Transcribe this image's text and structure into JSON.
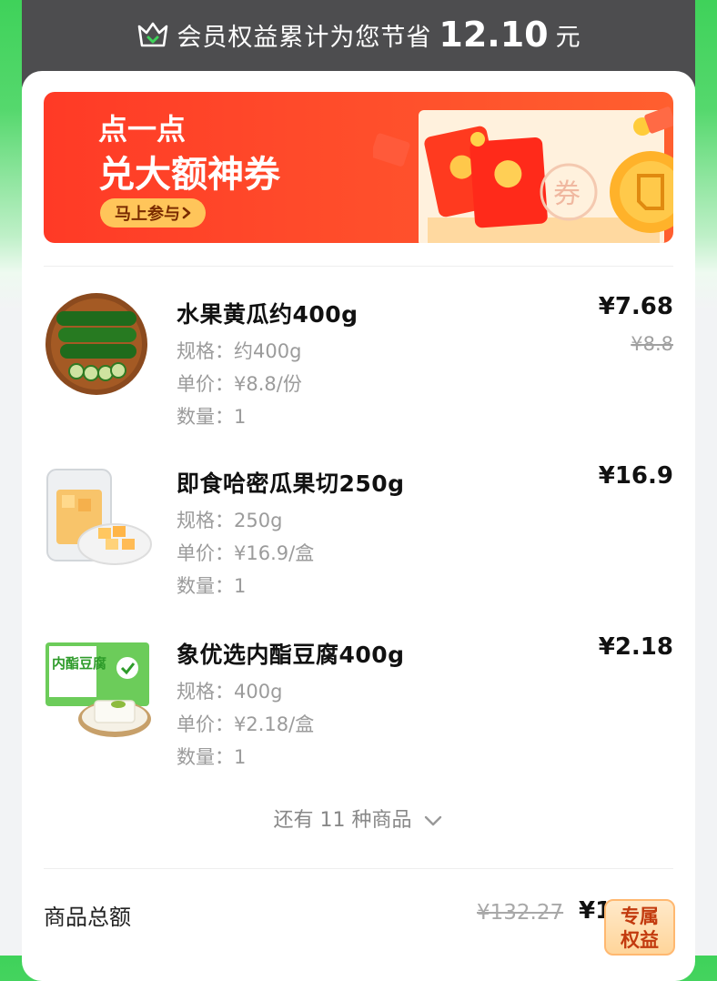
{
  "member": {
    "text": "会员权益累计为您节省",
    "amount": "12.10",
    "unit": "元"
  },
  "banner": {
    "line1": "点一点",
    "line2": "兑大额神券",
    "button": "马上参与",
    "coupon_char": "券"
  },
  "items": [
    {
      "name": "水果黄瓜约400g",
      "spec": "规格：约400g",
      "unit_price": "单价：¥8.8/份",
      "qty": "数量：1",
      "price": "¥7.68",
      "old_price": "¥8.8"
    },
    {
      "name": "即食哈密瓜果切250g",
      "spec": "规格：250g",
      "unit_price": "单价：¥16.9/盒",
      "qty": "数量：1",
      "price": "¥16.9"
    },
    {
      "name": "象优选内酯豆腐400g",
      "spec": "规格：400g",
      "unit_price": "单价：¥2.18/盒",
      "qty": "数量：1",
      "price": "¥2.18",
      "pkg_text": "内酯豆腐"
    }
  ],
  "more_text": "还有 11 种商品",
  "summary": {
    "label": "商品总额",
    "old_total": "¥132.27",
    "new_total": "¥1"
  },
  "badge": {
    "line1": "专属",
    "line2": "权益"
  },
  "colors": {
    "accent_red": "#ff4a2a",
    "member_bar": "#4d4d4f",
    "green_bg": "#3fd25a"
  }
}
